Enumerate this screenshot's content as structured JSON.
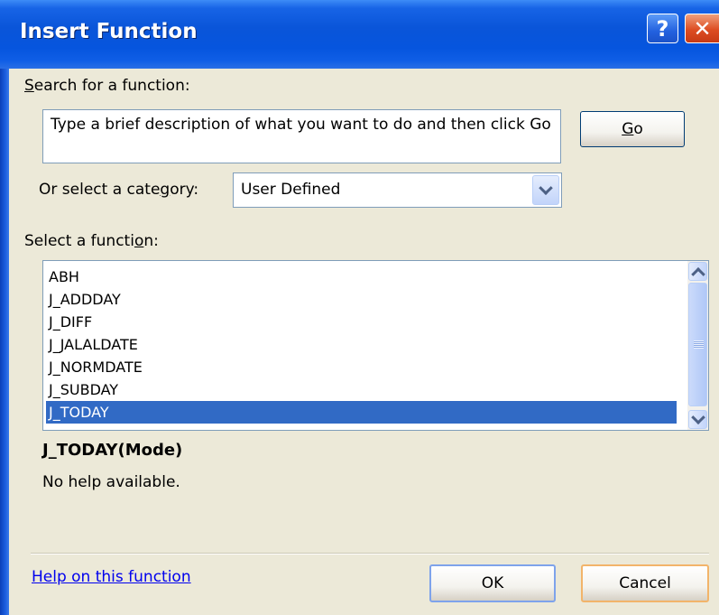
{
  "window": {
    "title": "Insert Function",
    "help_glyph": "?",
    "close_glyph": "✕"
  },
  "search": {
    "label": "Search for a function:",
    "value": "Type a brief description of what you want to do and then click Go",
    "go_label": "Go"
  },
  "category": {
    "label": "Or select a category:",
    "selected": "User Defined"
  },
  "functions": {
    "label": "Select a function:",
    "items": [
      "ABH",
      "J_ADDDAY",
      "J_DIFF",
      "J_JALALDATE",
      "J_NORMDATE",
      "J_SUBDAY",
      "J_TODAY"
    ],
    "selected_index": 6
  },
  "detail": {
    "signature": "J_TODAY(Mode)",
    "description": "No help available."
  },
  "footer": {
    "help_link": "Help on this function",
    "ok_label": "OK",
    "cancel_label": "Cancel"
  },
  "icons": {
    "help": "help-icon",
    "close": "close-icon",
    "dropdown": "chevron-down-icon",
    "scroll_up": "chevron-up-icon",
    "scroll_down": "chevron-down-icon"
  }
}
